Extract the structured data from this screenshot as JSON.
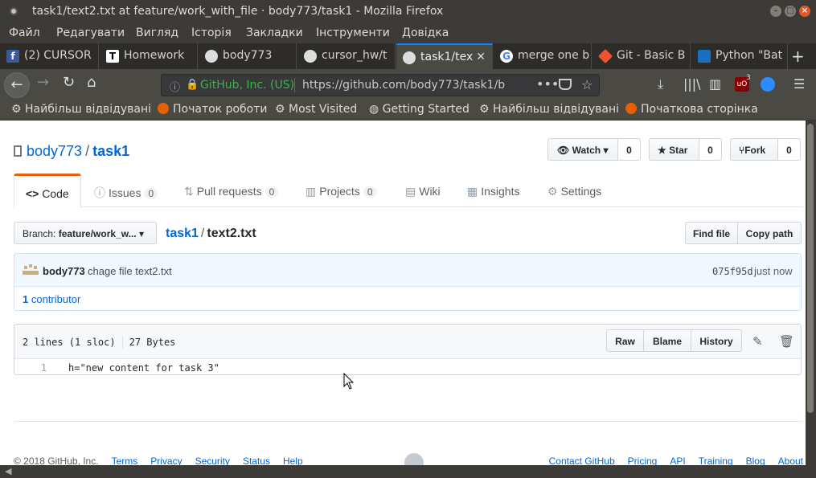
{
  "window": {
    "title": "task1/text2.txt at feature/work_with_file · body773/task1 - Mozilla Firefox"
  },
  "menu": [
    "Файл",
    "Редагувати",
    "Вигляд",
    "Історія",
    "Закладки",
    "Інструменти",
    "Довідка"
  ],
  "tabs": [
    {
      "label": "(2) CURSOR",
      "icon": "facebook-icon",
      "color": "#3b5998"
    },
    {
      "label": "Homework",
      "icon": "t-icon",
      "color": "#ffffff"
    },
    {
      "label": "body773",
      "icon": "github-icon",
      "color": "#24292e"
    },
    {
      "label": "cursor_hw/t",
      "icon": "github-icon",
      "color": "#24292e"
    },
    {
      "label": "task1/tex",
      "icon": "github-icon",
      "color": "#24292e",
      "active": true
    },
    {
      "label": "merge one b",
      "icon": "google-icon",
      "color": "#ffffff"
    },
    {
      "label": "Git - Basic B",
      "icon": "git-icon",
      "color": "#f05033"
    },
    {
      "label": "Python \"Bat",
      "icon": "pycharm-icon",
      "color": "#1a6fc4"
    }
  ],
  "urlbar": {
    "org": "GitHub, Inc. (US)",
    "url": "https://github.com/body773/task1/b"
  },
  "toolbar": {
    "ublock_badge": "3"
  },
  "bookmarks": [
    {
      "label": "Найбільш відвідувані",
      "icon": "gear-icon"
    },
    {
      "label": "Початок роботи",
      "icon": "firefox-icon"
    },
    {
      "label": "Most Visited",
      "icon": "gear-icon"
    },
    {
      "label": "Getting Started",
      "icon": "globe-icon"
    },
    {
      "label": "Найбільш відвідувані",
      "icon": "gear-icon"
    },
    {
      "label": "Початкова сторінка",
      "icon": "firefox-icon"
    }
  ],
  "repo": {
    "owner": "body773",
    "name": "task1",
    "watch": {
      "label": "Watch",
      "count": "0"
    },
    "star": {
      "label": "Star",
      "count": "0"
    },
    "fork": {
      "label": "Fork",
      "count": "0"
    }
  },
  "reponav": {
    "code": "Code",
    "issues": {
      "label": "Issues",
      "count": "0"
    },
    "pulls": {
      "label": "Pull requests",
      "count": "0"
    },
    "projects": {
      "label": "Projects",
      "count": "0"
    },
    "wiki": "Wiki",
    "insights": "Insights",
    "settings": "Settings"
  },
  "file_nav": {
    "branch_prefix": "Branch:",
    "branch": "feature/work_w...",
    "repo": "task1",
    "file": "text2.txt",
    "find_file": "Find file",
    "copy_path": "Copy path"
  },
  "commit": {
    "author": "body773",
    "message": "chage file text2.txt",
    "sha": "075f95d",
    "when": "just now",
    "contributors_count": "1",
    "contributors_label": "contributor"
  },
  "file": {
    "lines": "2 lines (1 sloc)",
    "size": "27 Bytes",
    "raw": "Raw",
    "blame": "Blame",
    "history": "History",
    "code": [
      {
        "num": "1",
        "text": "h=\"new content for task 3\""
      }
    ]
  },
  "footer": {
    "copyright": "© 2018 GitHub, Inc.",
    "left_links": [
      "Terms",
      "Privacy",
      "Security",
      "Status",
      "Help"
    ],
    "right_links": [
      "Contact GitHub",
      "Pricing",
      "API",
      "Training",
      "Blog",
      "About"
    ]
  }
}
